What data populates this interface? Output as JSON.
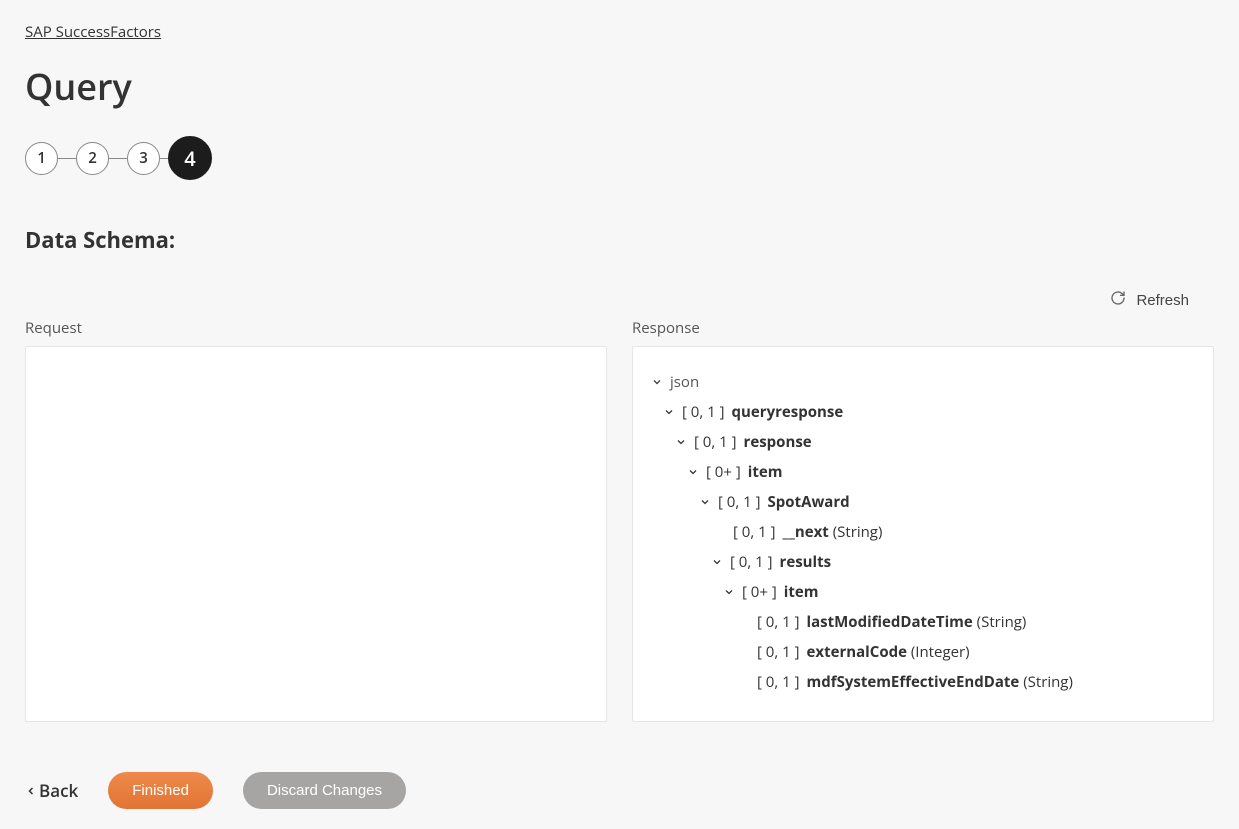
{
  "breadcrumb": "SAP SuccessFactors",
  "page_title": "Query",
  "stepper": [
    "1",
    "2",
    "3",
    "4"
  ],
  "stepper_active_index": 3,
  "section_heading": "Data Schema:",
  "refresh_label": "Refresh",
  "request_label": "Request",
  "response_label": "Response",
  "response_tree": {
    "root": "json",
    "c_queryresponse": "[ 0, 1 ]",
    "n_queryresponse": "queryresponse",
    "c_response": "[ 0, 1 ]",
    "n_response": "response",
    "c_item1": "[ 0+ ]",
    "n_item1": "item",
    "c_spotaward": "[ 0, 1 ]",
    "n_spotaward": "SpotAward",
    "c_next": "[ 0, 1 ]",
    "n_next": "__next",
    "t_next": " (String)",
    "c_results": "[ 0, 1 ]",
    "n_results": "results",
    "c_item2": "[ 0+ ]",
    "n_item2": "item",
    "c_lastmod": "[ 0, 1 ]",
    "n_lastmod": "lastModifiedDateTime",
    "t_lastmod": " (String)",
    "c_extcode": "[ 0, 1 ]",
    "n_extcode": "externalCode",
    "t_extcode": " (Integer)",
    "c_mdfdate": "[ 0, 1 ]",
    "n_mdfdate": "mdfSystemEffectiveEndDate",
    "t_mdfdate": " (String)"
  },
  "footer": {
    "back": "Back",
    "finished": "Finished",
    "discard": "Discard Changes"
  }
}
